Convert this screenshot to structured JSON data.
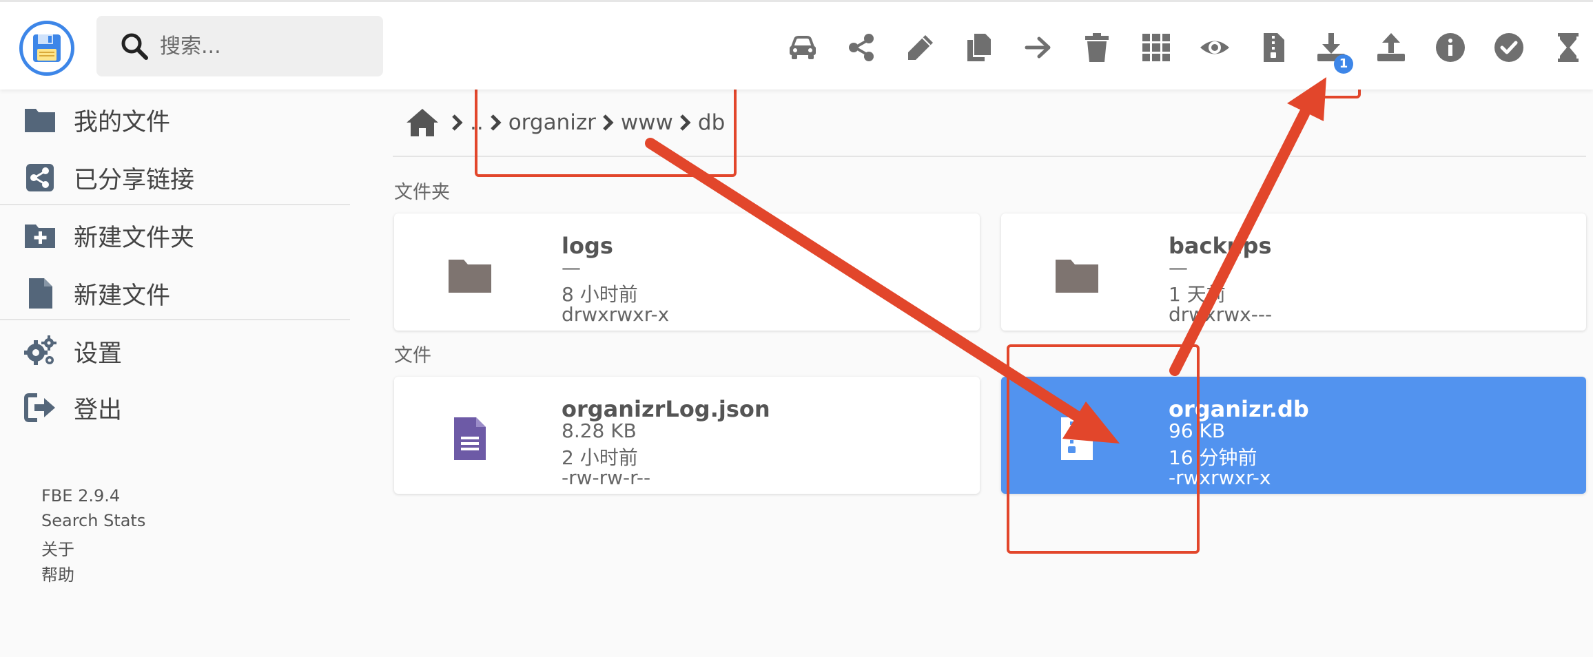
{
  "app": {
    "accent_color": "#3d86e8",
    "selected_color": "#5293ef",
    "annotation_color": "#e2462b"
  },
  "search": {
    "placeholder": "搜索..."
  },
  "toolbar": {
    "icons": [
      "car-icon",
      "share-icon",
      "pencil-icon",
      "copy-icon",
      "arrow-right-icon",
      "trash-icon",
      "grid-icon",
      "eye-icon",
      "zip-file-icon",
      "download-icon",
      "upload-icon",
      "info-icon",
      "check-icon",
      "hourglass-icon"
    ],
    "download_badge": "1"
  },
  "sidebar": {
    "items": [
      {
        "label": "我的文件",
        "icon": "folder-icon"
      },
      {
        "label": "已分享链接",
        "icon": "share-square-icon"
      },
      {
        "label": "新建文件夹",
        "icon": "folder-plus-icon"
      },
      {
        "label": "新建文件",
        "icon": "file-icon"
      },
      {
        "label": "设置",
        "icon": "gears-icon"
      },
      {
        "label": "登出",
        "icon": "sign-out-icon"
      }
    ],
    "footer": [
      "FBE 2.9.4",
      "Search Stats",
      "关于",
      "帮助"
    ]
  },
  "breadcrumb": [
    "..",
    "organizr",
    "www",
    "db"
  ],
  "sections": {
    "folders": "文件夹",
    "files": "文件"
  },
  "folders": [
    {
      "name": "logs",
      "size": "—",
      "modified": "8 小时前",
      "perms": "drwxrwxr-x"
    },
    {
      "name": "backups",
      "size": "—",
      "modified": "1 天前",
      "perms": "drwxrwx---"
    }
  ],
  "files": [
    {
      "name": "organizrLog.json",
      "size": "8.28 KB",
      "modified": "2 小时前",
      "perms": "-rw-rw-r--",
      "selected": false
    },
    {
      "name": "organizr.db",
      "size": "96 KB",
      "modified": "16 分钟前",
      "perms": "-rwxrwxr-x",
      "selected": true
    }
  ]
}
